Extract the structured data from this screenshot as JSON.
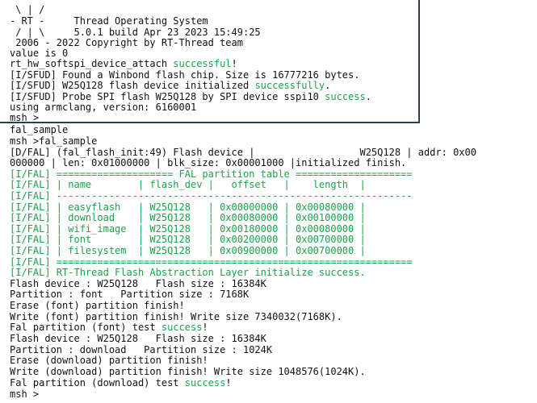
{
  "colors": {
    "text": "#111111",
    "success": "#1aa34a",
    "panel_border": "#2c3e50",
    "background": "#ffffff"
  },
  "top_panel": {
    "lines": [
      {
        "text": " \\ | /"
      },
      {
        "text": "- RT -     Thread Operating System"
      },
      {
        "text": " / | \\     5.0.1 build Apr 23 2023 15:49:25"
      },
      {
        "text": " 2006 - 2022 Copyright by RT-Thread team"
      },
      {
        "text": "value is 0"
      },
      {
        "a": "rt_hw_softspi_device_attach ",
        "b": "successful",
        "c": "!"
      },
      {
        "text": "[I/SFUD] Found a Winbond flash chip. Size is 16777216 bytes."
      },
      {
        "a": "[I/SFUD] W25Q128 flash device initialized ",
        "b": "successfully",
        "c": "."
      },
      {
        "a": "[I/SFUD] Probe SPI flash W25Q128 by SPI device sspi10 ",
        "b": "success",
        "c": "."
      },
      {
        "text": "using armclang, version: 6160001"
      },
      {
        "text": "msh >"
      }
    ]
  },
  "console": {
    "lines": [
      {
        "text": "fal_sample"
      },
      {
        "text": "msh >fal_sample"
      },
      {
        "text": "[D/FAL] (fal_flash_init:49) Flash device |                  W25Q128 | addr: 0x00"
      },
      {
        "text": "000000 | len: 0x01000000 | blk_size: 0x00001000 |initialized finish."
      },
      {
        "fal": "[I/FAL] ==================== FAL partition table ===================="
      },
      {
        "fal": "[I/FAL] | name        | flash_dev |   offset   |    length  |"
      },
      {
        "fal": "[I/FAL] -------------------------------------------------------------"
      },
      {
        "fal": "[I/FAL] | easyflash   | W25Q128   | 0x00000000 | 0x00080000 |"
      },
      {
        "fal": "[I/FAL] | download    | W25Q128   | 0x00080000 | 0x00100000 |"
      },
      {
        "fal": "[I/FAL] | wifi_image  | W25Q128   | 0x00180000 | 0x00080000 |"
      },
      {
        "fal": "[I/FAL] | font        | W25Q128   | 0x00200000 | 0x00700000 |"
      },
      {
        "fal": "[I/FAL] | filesystem  | W25Q128   | 0x00900000 | 0x00700000 |"
      },
      {
        "fal": "[I/FAL] ============================================================="
      },
      {
        "fal": "[I/FAL] RT-Thread Flash Abstraction Layer initialize success."
      },
      {
        "text": "Flash device : W25Q128   Flash size : 16384K"
      },
      {
        "text": "Partition : font   Partition size : 7168K"
      },
      {
        "text": "Erase (font) partition finish!"
      },
      {
        "text": "Write (font) partition finish! Write size 7340032(7168K)."
      },
      {
        "a": "Fal partition (font) test ",
        "b": "success",
        "c": "!"
      },
      {
        "text": "Flash device : W25Q128   Flash size : 16384K"
      },
      {
        "text": "Partition : download   Partition size : 1024K"
      },
      {
        "text": "Erase (download) partition finish!"
      },
      {
        "text": "Write (download) partition finish! Write size 1048576(1024K)."
      },
      {
        "a": "Fal partition (download) test ",
        "b": "success",
        "c": "!"
      },
      {
        "text": "msh >"
      }
    ]
  }
}
